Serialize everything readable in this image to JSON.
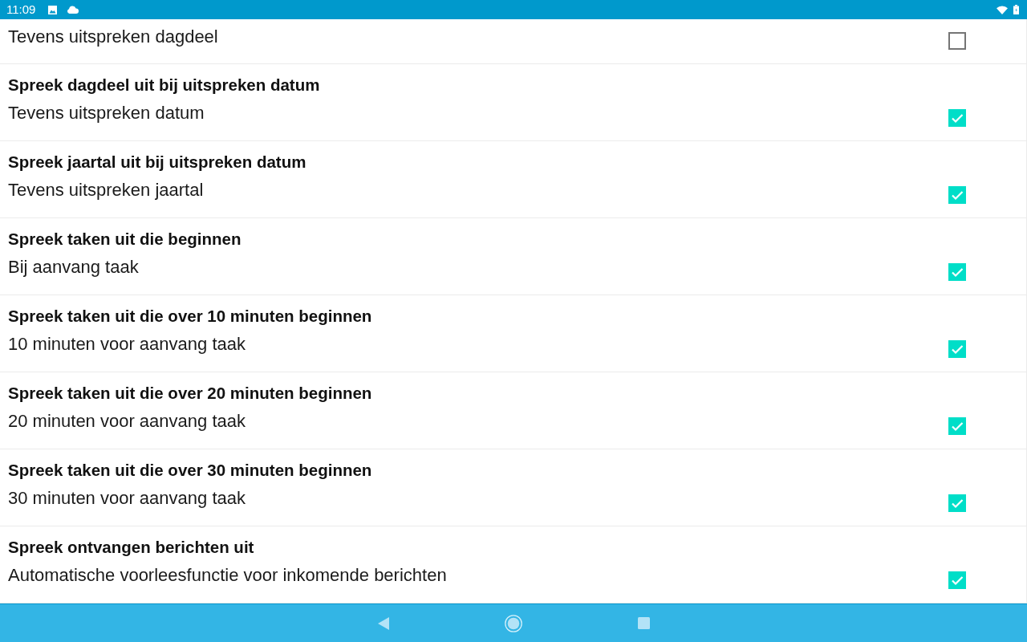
{
  "status_bar": {
    "time": "11:09"
  },
  "settings": [
    {
      "summary": "Tevens uitspreken dagdeel",
      "checked": false
    },
    {
      "title": "Spreek dagdeel uit bij uitspreken datum",
      "summary": "Tevens uitspreken datum",
      "checked": true
    },
    {
      "title": "Spreek jaartal uit bij uitspreken datum",
      "summary": "Tevens uitspreken jaartal",
      "checked": true
    },
    {
      "title": "Spreek taken uit die beginnen",
      "summary": "Bij aanvang taak",
      "checked": true
    },
    {
      "title": "Spreek taken uit die over 10 minuten beginnen",
      "summary": "10 minuten voor aanvang taak",
      "checked": true
    },
    {
      "title": "Spreek taken uit die over 20 minuten beginnen",
      "summary": "20 minuten voor aanvang taak",
      "checked": true
    },
    {
      "title": "Spreek taken uit die over 30 minuten beginnen",
      "summary": "30 minuten voor aanvang taak",
      "checked": true
    },
    {
      "title": "Spreek ontvangen berichten uit",
      "summary": "Automatische voorleesfunctie voor inkomende berichten",
      "checked": true
    }
  ]
}
